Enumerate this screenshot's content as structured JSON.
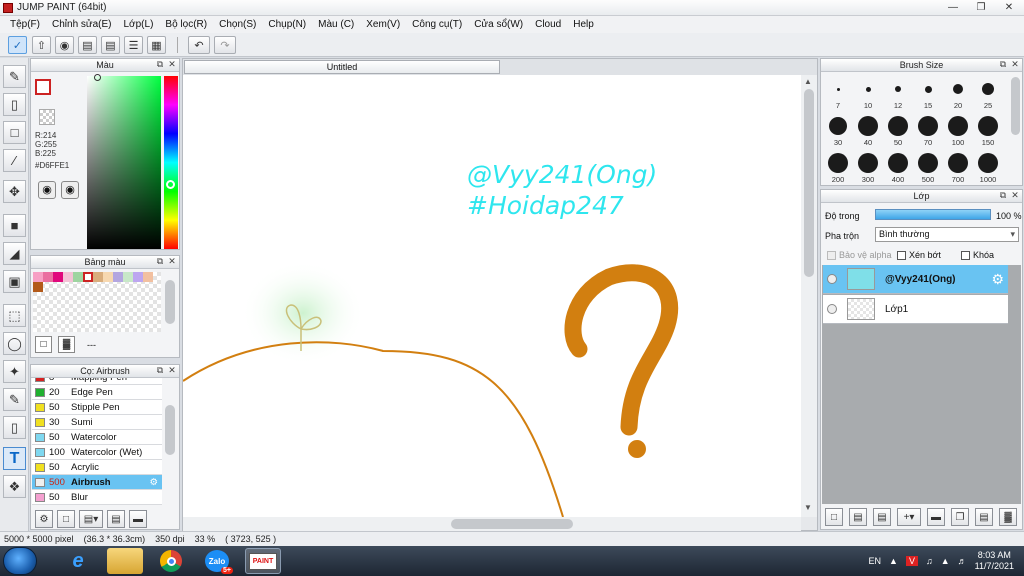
{
  "window": {
    "title": "JUMP PAINT (64bit)"
  },
  "menu": [
    "Tệp(F)",
    "Chỉnh sửa(E)",
    "Lớp(L)",
    "Bộ lọc(R)",
    "Chọn(S)",
    "Chụp(N)",
    "Màu (C)",
    "Xem(V)",
    "Công cụ(T)",
    "Cửa sổ(W)",
    "Cloud",
    "Help"
  ],
  "color_panel": {
    "title": "Màu",
    "r": "R:214",
    "g": "G:255",
    "b": "B:225",
    "hex": "#D6FFE1",
    "fg_color": "#ffffff",
    "bg_color": "#000000"
  },
  "palette_panel": {
    "title": "Bảng màu",
    "swatches": [
      "#f7a0c4",
      "#ea6fa0",
      "#e0087c",
      "#f4c2d6",
      "#9ed4a0",
      "#ffffff",
      "#d9ad7c",
      "#f7d8b0",
      "#b3a6e0",
      "#c8e8c8",
      "#bda6f0",
      "#f2c0a0",
      "#b35a1a"
    ],
    "label": "---"
  },
  "brush_list": {
    "title": "Cọ: Airbrush",
    "items": [
      {
        "size": "8",
        "name": "Mapping Pen",
        "color": "#d62020"
      },
      {
        "size": "20",
        "name": "Edge Pen",
        "color": "#20b030"
      },
      {
        "size": "50",
        "name": "Stipple Pen",
        "color": "#f0e020"
      },
      {
        "size": "30",
        "name": "Sumi",
        "color": "#f0e020"
      },
      {
        "size": "50",
        "name": "Watercolor",
        "color": "#7fd8f0"
      },
      {
        "size": "100",
        "name": "Watercolor (Wet)",
        "color": "#7fd8f0"
      },
      {
        "size": "50",
        "name": "Acrylic",
        "color": "#f0e020"
      },
      {
        "size": "500",
        "name": "Airbrush",
        "color": "#f0f0f0",
        "selected": true
      },
      {
        "size": "50",
        "name": "Blur",
        "color": "#f4a0d0"
      }
    ]
  },
  "canvas": {
    "tab_title": "Untitled",
    "text_line1": "@Vyy241(Ong)",
    "text_line2": "#Hoidap247",
    "text_color": "#2ee6ee",
    "stroke_color": "#d27f10"
  },
  "brush_size": {
    "title": "Brush Size",
    "sizes": [
      "7",
      "10",
      "12",
      "15",
      "20",
      "25",
      "30",
      "40",
      "50",
      "70",
      "100",
      "150",
      "200",
      "300",
      "400",
      "500",
      "700",
      "1000"
    ]
  },
  "layers": {
    "title": "Lớp",
    "opacity_label": "Độ trong",
    "opacity_value": "100 %",
    "blend_label": "Pha trộn",
    "blend_value": "Bình thường",
    "chk_alpha": "Bảo vệ alpha",
    "chk_clip": "Xén bớt",
    "chk_lock": "Khóa",
    "items": [
      {
        "name": "@Vyy241(Ong)",
        "selected": true
      },
      {
        "name": "Lớp1",
        "selected": false
      }
    ]
  },
  "status": {
    "size": "5000 * 5000 pixel",
    "cm": "(36.3 * 36.3cm)",
    "dpi": "350 dpi",
    "zoom": "33 %",
    "coords": "( 3723, 525 )"
  },
  "taskbar": {
    "lang": "EN",
    "time": "8:03 AM",
    "date": "11/7/2021",
    "zalo": "Zalo",
    "zalo_badge": "5+",
    "paint": "PAINT"
  }
}
